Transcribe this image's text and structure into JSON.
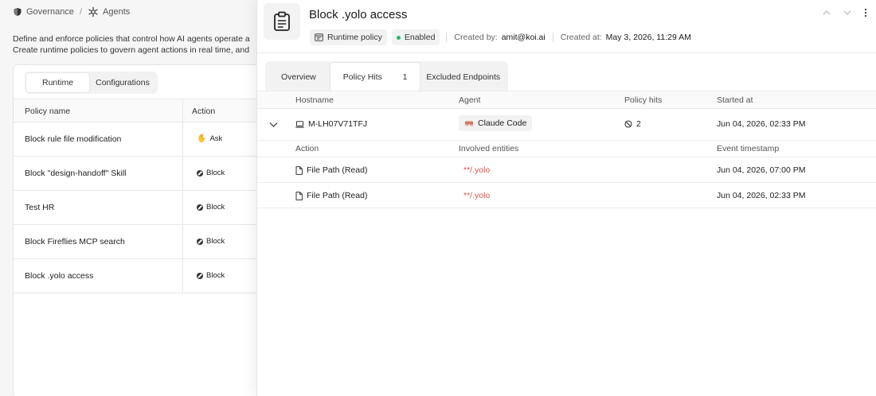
{
  "breadcrumb": {
    "root": "Governance",
    "separator": "/",
    "current": "Agents"
  },
  "page": {
    "description_line1": "Define and enforce policies that control how AI agents operate a",
    "description_line2": "Create runtime policies to govern agent actions in real time, and"
  },
  "segments": [
    "Runtime",
    "Configurations"
  ],
  "policy_table": {
    "headers": {
      "name": "Policy name",
      "action": "Action"
    },
    "rows": [
      {
        "name": "Block rule file modification",
        "action": "Ask"
      },
      {
        "name": "Block \"design-handoff\" Skill",
        "action": "Block"
      },
      {
        "name": "Test HR",
        "action": "Block"
      },
      {
        "name": "Block Fireflies MCP search",
        "action": "Block"
      },
      {
        "name": "Block .yolo access",
        "action": "Block"
      }
    ]
  },
  "drawer": {
    "title": "Block .yolo access",
    "chips": {
      "type": "Runtime policy",
      "status": "Enabled"
    },
    "created_by_label": "Created by:",
    "created_by": "amit@koi.ai",
    "created_at_label": "Created at:",
    "created_at": "May 3, 2026, 11:29 AM",
    "tabs": [
      {
        "label": "Overview"
      },
      {
        "label": "Policy Hits",
        "count": "1"
      },
      {
        "label": "Excluded Endpoints"
      }
    ],
    "hits_headers": {
      "hostname": "Hostname",
      "agent": "Agent",
      "policy_hits": "Policy hits",
      "started_at": "Started at"
    },
    "hit": {
      "hostname": "M-LH07V71TFJ",
      "agent": "Claude Code",
      "policy_hits": "2",
      "started_at": "Jun 04, 2026, 02:33 PM"
    },
    "detail_headers": {
      "action": "Action",
      "entities": "Involved entities",
      "timestamp": "Event timestamp"
    },
    "events": [
      {
        "action": "File Path (Read)",
        "entity": "**/.yolo",
        "timestamp": "Jun 04, 2026, 07:00 PM"
      },
      {
        "action": "File Path (Read)",
        "entity": "**/.yolo",
        "timestamp": "Jun 04, 2026, 02:33 PM"
      }
    ]
  },
  "colors": {
    "enabled": "#2bb673",
    "entity": "#e05252",
    "agent_icon": "#d9785a"
  }
}
